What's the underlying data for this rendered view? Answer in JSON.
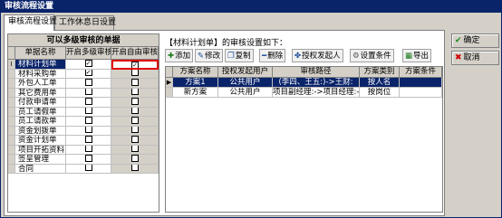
{
  "window": {
    "title": "审核流程设置"
  },
  "tabs": [
    {
      "label": "审核流程设置",
      "active": true
    },
    {
      "label": "工作休息日设置",
      "active": false
    }
  ],
  "left_panel": {
    "title": "可以多级审核的单据",
    "columns": [
      "单据名称",
      "开启多级审核",
      "开启自由审核"
    ],
    "rows": [
      {
        "indicator": "I",
        "name": "材料计划单",
        "multi": true,
        "free": true,
        "selected": true
      },
      {
        "indicator": "",
        "name": "材料采购单",
        "multi": true,
        "free": false,
        "selected": false
      },
      {
        "indicator": "",
        "name": "外包人工单",
        "multi": false,
        "free": false,
        "selected": false
      },
      {
        "indicator": "",
        "name": "其它费用单",
        "multi": false,
        "free": false,
        "selected": false
      },
      {
        "indicator": "",
        "name": "付款申请单",
        "multi": false,
        "free": false,
        "selected": false
      },
      {
        "indicator": "",
        "name": "员工请假单",
        "multi": false,
        "free": false,
        "selected": false
      },
      {
        "indicator": "",
        "name": "员工请款单",
        "multi": false,
        "free": false,
        "selected": false
      },
      {
        "indicator": "",
        "name": "资金划拨单",
        "multi": false,
        "free": false,
        "selected": false
      },
      {
        "indicator": "",
        "name": "资金计划单",
        "multi": false,
        "free": false,
        "selected": false
      },
      {
        "indicator": "",
        "name": "项目开拓资料",
        "multi": false,
        "free": false,
        "selected": false
      },
      {
        "indicator": "",
        "name": "签呈管理",
        "multi": false,
        "free": false,
        "selected": false
      },
      {
        "indicator": "",
        "name": "合同",
        "multi": false,
        "free": false,
        "selected": false
      }
    ]
  },
  "right_panel": {
    "label": "【材料计划单】的审核设置如下：",
    "toolbar": [
      {
        "icon": "plus-icon",
        "glyph": "✚",
        "color": "#1a7a1a",
        "label": "添加"
      },
      {
        "icon": "edit-icon",
        "glyph": "✎",
        "color": "#1a4a9a",
        "label": "修改"
      },
      {
        "icon": "copy-icon",
        "glyph": "❐",
        "color": "#1a4a9a",
        "label": "复制"
      },
      {
        "icon": "minus-icon",
        "glyph": "━",
        "color": "#1a4a9a",
        "label": "删除"
      },
      {
        "icon": "authorize-icon",
        "glyph": "✤",
        "color": "#1a4a9a",
        "label": "授权发起人"
      },
      {
        "icon": "condition-icon",
        "glyph": "⚙",
        "color": "#555555",
        "label": "设置条件"
      },
      {
        "icon": "export-icon",
        "glyph": "▦",
        "color": "#1a7a1a",
        "label": "导出"
      }
    ],
    "columns": [
      "方案名称",
      "授权发起用户",
      "审核路径",
      "方案类别",
      "方案条件"
    ],
    "rows": [
      {
        "indicator": "▶",
        "name": "方案1",
        "user": "公共用户",
        "path": "(李四、王五:)->王财:",
        "category": "按人名",
        "condition": "",
        "selected": true
      },
      {
        "indicator": "",
        "name": "新方案",
        "user": "公共用户",
        "path": "项目副经理:->项目经理:-",
        "category": "按岗位",
        "condition": "",
        "selected": false
      }
    ]
  },
  "side_buttons": {
    "ok": "确定",
    "cancel": "取消"
  }
}
